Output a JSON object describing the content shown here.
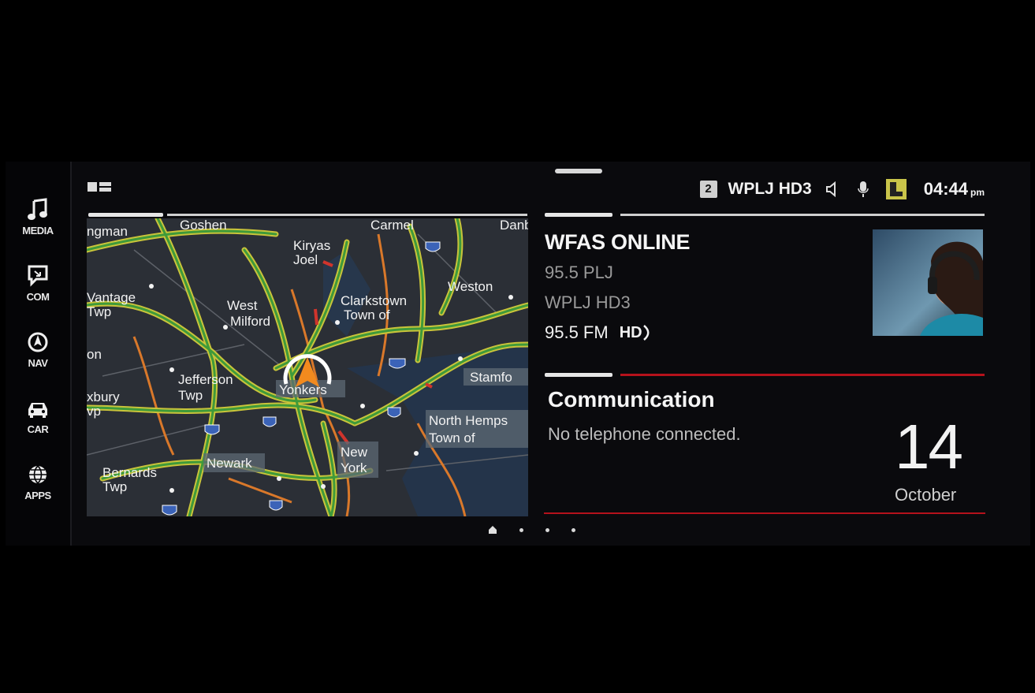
{
  "sidebar": {
    "items": [
      {
        "label": "MEDIA",
        "icon": "music-note-icon"
      },
      {
        "label": "COM",
        "icon": "communication-icon"
      },
      {
        "label": "NAV",
        "icon": "navigation-icon"
      },
      {
        "label": "CAR",
        "icon": "car-icon"
      },
      {
        "label": "APPS",
        "icon": "globe-icon"
      }
    ]
  },
  "status_bar": {
    "preset": "2",
    "station": "WPLJ HD3",
    "time": "04:44",
    "ampm": "pm"
  },
  "map": {
    "labels": {
      "ingman": "ngman",
      "goshen": "Goshen",
      "carmel": "Carmel",
      "danbury": "Danb",
      "kiryas": "Kiryas",
      "joel": "Joel",
      "vantage": "Vantage",
      "twp1": "Twp",
      "west_milford_1": "West",
      "west_milford_2": "Milford",
      "clarkstown_1": "Clarkstown",
      "clarkstown_2": "Town of",
      "weston": "Weston",
      "on": "on",
      "jefferson_1": "Jefferson",
      "jefferson_2": "Twp",
      "yonkers": "Yonkers",
      "stamford": "Stamfo",
      "roxbury_1": "xbury",
      "roxbury_2": "vp",
      "north_hemp_1": "North Hemps",
      "north_hemp_2": "Town of",
      "newark": "Newark",
      "new_york_1": "New",
      "new_york_2": "York",
      "bernards_1": "Bernards",
      "bernards_2": "Twp"
    }
  },
  "media": {
    "title": "WFAS ONLINE",
    "line1": "95.5 PLJ",
    "line2": "WPLJ HD3",
    "frequency": "95.5 FM",
    "hd_badge": "HD"
  },
  "communication": {
    "title": "Communication",
    "message": "No telephone connected.",
    "day": "14",
    "month": "October"
  },
  "colors": {
    "accent_red": "#b5121b",
    "map_bg": "#2b2f36"
  }
}
